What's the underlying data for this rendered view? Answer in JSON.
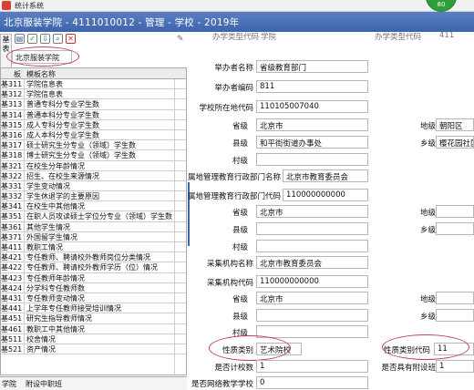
{
  "window": {
    "title": "统计系统",
    "badge": "80"
  },
  "header": {
    "title": "北京服装学院 - 4111010012 - 管理 - 学校 - 2019年"
  },
  "toolbar": {
    "buttons": [
      {
        "name": "open-icon",
        "glyph": "▤"
      },
      {
        "name": "check-icon",
        "glyph": "✓"
      },
      {
        "name": "import-icon",
        "glyph": "⇩"
      },
      {
        "name": "search-icon",
        "glyph": "⌕"
      },
      {
        "name": "delete-icon",
        "glyph": "✕"
      }
    ]
  },
  "side_tab": {
    "label": "基表"
  },
  "school_selector": {
    "value": "北京服装学院"
  },
  "template_list": {
    "headers": [
      "板",
      "模板名称"
    ],
    "rows": [
      {
        "code": "基311",
        "name": "学院信息表"
      },
      {
        "code": "基312",
        "name": "学院信息表"
      },
      {
        "code": "基313",
        "name": "普通专科分专业学生数"
      },
      {
        "code": "基314",
        "name": "普通本科分专业学生数"
      },
      {
        "code": "基315",
        "name": "成人专科分专业学生数"
      },
      {
        "code": "基316",
        "name": "成人本科分专业学生数"
      },
      {
        "code": "基317",
        "name": "硕士研究生分专业（领域）学生数"
      },
      {
        "code": "基318",
        "name": "博士研究生分专业（领域）学生数"
      },
      {
        "code": "基321",
        "name": "在校生分年龄情况"
      },
      {
        "code": "基322",
        "name": "招生、在校生来源情况"
      },
      {
        "code": "基331",
        "name": "学生变动情况"
      },
      {
        "code": "基332",
        "name": "学生休退学的主要原因"
      },
      {
        "code": "基341",
        "name": "在校生中其他情况"
      },
      {
        "code": "基351",
        "name": "在职人员攻读硕士学位分专业（领域）学生数"
      },
      {
        "code": "基361",
        "name": "其他学生情况"
      },
      {
        "code": "基371",
        "name": "外国留学生情况"
      },
      {
        "code": "基411",
        "name": "教职工情况"
      },
      {
        "code": "基421",
        "name": "专任教师、聘请校外教师岗位分类情况"
      },
      {
        "code": "基422",
        "name": "专任教师、聘请校外教师学历（位）情况"
      },
      {
        "code": "基423",
        "name": "专任教师年龄情况"
      },
      {
        "code": "基424",
        "name": "分学科专任教师数"
      },
      {
        "code": "基431",
        "name": "专任教师变动情况"
      },
      {
        "code": "基441",
        "name": "上学年专任教师接受培训情况"
      },
      {
        "code": "基451",
        "name": "研究生指导教师情况"
      },
      {
        "code": "基461",
        "name": "教职工中其他情况"
      },
      {
        "code": "基511",
        "name": "校舍情况"
      },
      {
        "code": "基521",
        "name": "资产情况"
      }
    ]
  },
  "bottom_tabs": [
    "学院",
    "附设中职班"
  ],
  "form": {
    "top_partial": {
      "left_label": "办学类型代码",
      "left_value": "学院",
      "right_label": "办学类型代码",
      "right_value": "411"
    },
    "sponsor_name_label": "举办者名称",
    "sponsor_name": "省级教育部门",
    "sponsor_code_label": "举办者编码",
    "sponsor_code": "811",
    "school_area_code_label": "学校所在地代码",
    "school_area_code": "110105007040",
    "province_label": "省级",
    "province": "北京市",
    "city_label": "地级",
    "city": "朝阳区",
    "county_label": "县级",
    "county": "和平街街道办事处",
    "township_label": "乡级",
    "township": "樱花园社区居委会",
    "village_label": "村级",
    "village": "",
    "dept_name_label": "属地管理教育行政部门名称",
    "dept_name": "北京市教育委员会",
    "dept_code_label": "属地管理教育行政部门代码",
    "dept_code": "110000000000",
    "dept_province_label": "省级",
    "dept_province": "北京市",
    "dept_city_label": "地级",
    "dept_city": "",
    "dept_county_label": "县级",
    "dept_county": "",
    "dept_township_label": "乡级",
    "dept_township": "",
    "dept_village_label": "村级",
    "dept_village": "",
    "collect_name_label": "采集机构名称",
    "collect_name": "北京市教育委员会",
    "collect_code_label": "采集机构代码",
    "collect_code": "110000000000",
    "collect_province_label": "省级",
    "collect_province": "北京市",
    "collect_city_label": "地级",
    "collect_city": "",
    "collect_county_label": "县级",
    "collect_county": "",
    "collect_township_label": "乡级",
    "collect_township": "",
    "collect_village_label": "村级",
    "collect_village": "",
    "nature_type_label": "性质类别",
    "nature_type": "艺术院校",
    "nature_code_label": "性质类别代码",
    "nature_code": "11",
    "branch_count_label": "是否计校数",
    "branch_count": "1",
    "has_branch_label": "是否具有附设班",
    "has_branch": "1",
    "network_school_label": "是否网络教学学校",
    "network_school": "0"
  }
}
